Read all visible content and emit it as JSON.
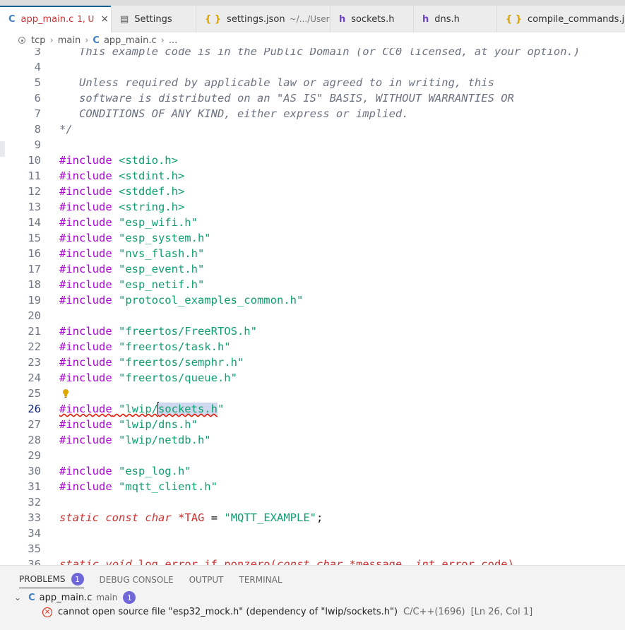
{
  "tabs": [
    {
      "icon": "c",
      "icon_char": "C",
      "label": "app_main.c",
      "detail": "1, U",
      "active": true,
      "error": true,
      "close": "×"
    },
    {
      "icon": "settings",
      "icon_char": "▤",
      "label": "Settings"
    },
    {
      "icon": "json",
      "icon_char": "{ }",
      "label": "settings.json",
      "desc": "~/.../User"
    },
    {
      "icon": "h",
      "icon_char": "h",
      "label": "sockets.h"
    },
    {
      "icon": "h",
      "icon_char": "h",
      "label": "dns.h"
    },
    {
      "icon": "json",
      "icon_char": "{ }",
      "label": "compile_commands.json"
    }
  ],
  "breadcrumbs": {
    "folder1": "tcp",
    "folder2": "main",
    "file_icon": "C",
    "file": "app_main.c",
    "more": "...",
    "sep": "›"
  },
  "lines": [
    {
      "n": "3",
      "segs": [
        {
          "t": "   This example code is in the Public Domain (or CC0 licensed, at your option.)",
          "c": "com"
        }
      ]
    },
    {
      "n": "4",
      "segs": []
    },
    {
      "n": "5",
      "segs": [
        {
          "t": "   Unless required by applicable law or agreed to in writing, this",
          "c": "com"
        }
      ]
    },
    {
      "n": "6",
      "segs": [
        {
          "t": "   software is distributed on an \"AS IS\" BASIS, WITHOUT WARRANTIES OR",
          "c": "com"
        }
      ]
    },
    {
      "n": "7",
      "segs": [
        {
          "t": "   CONDITIONS OF ANY KIND, either express or implied.",
          "c": "com"
        }
      ]
    },
    {
      "n": "8",
      "segs": [
        {
          "t": "*/",
          "c": "com"
        }
      ]
    },
    {
      "n": "9",
      "segs": []
    },
    {
      "n": "10",
      "segs": [
        {
          "t": "#include",
          "c": "inc"
        },
        {
          "t": " <stdio.h>",
          "c": "str"
        }
      ]
    },
    {
      "n": "11",
      "segs": [
        {
          "t": "#include",
          "c": "inc"
        },
        {
          "t": " <stdint.h>",
          "c": "str"
        }
      ]
    },
    {
      "n": "12",
      "segs": [
        {
          "t": "#include",
          "c": "inc"
        },
        {
          "t": " <stddef.h>",
          "c": "str"
        }
      ]
    },
    {
      "n": "13",
      "segs": [
        {
          "t": "#include",
          "c": "inc"
        },
        {
          "t": " <string.h>",
          "c": "str"
        }
      ]
    },
    {
      "n": "14",
      "segs": [
        {
          "t": "#include",
          "c": "inc"
        },
        {
          "t": " \"esp_wifi.h\"",
          "c": "str"
        }
      ]
    },
    {
      "n": "15",
      "segs": [
        {
          "t": "#include",
          "c": "inc"
        },
        {
          "t": " \"esp_system.h\"",
          "c": "str"
        }
      ]
    },
    {
      "n": "16",
      "segs": [
        {
          "t": "#include",
          "c": "inc"
        },
        {
          "t": " \"nvs_flash.h\"",
          "c": "str"
        }
      ]
    },
    {
      "n": "17",
      "segs": [
        {
          "t": "#include",
          "c": "inc"
        },
        {
          "t": " \"esp_event.h\"",
          "c": "str"
        }
      ]
    },
    {
      "n": "18",
      "segs": [
        {
          "t": "#include",
          "c": "inc"
        },
        {
          "t": " \"esp_netif.h\"",
          "c": "str"
        }
      ]
    },
    {
      "n": "19",
      "segs": [
        {
          "t": "#include",
          "c": "inc"
        },
        {
          "t": " \"protocol_examples_common.h\"",
          "c": "str"
        }
      ]
    },
    {
      "n": "20",
      "segs": []
    },
    {
      "n": "21",
      "segs": [
        {
          "t": "#include",
          "c": "inc"
        },
        {
          "t": " \"freertos/FreeRTOS.h\"",
          "c": "str"
        }
      ]
    },
    {
      "n": "22",
      "segs": [
        {
          "t": "#include",
          "c": "inc"
        },
        {
          "t": " \"freertos/task.h\"",
          "c": "str"
        }
      ]
    },
    {
      "n": "23",
      "segs": [
        {
          "t": "#include",
          "c": "inc"
        },
        {
          "t": " \"freertos/semphr.h\"",
          "c": "str"
        }
      ]
    },
    {
      "n": "24",
      "segs": [
        {
          "t": "#include",
          "c": "inc"
        },
        {
          "t": " \"freertos/queue.h\"",
          "c": "str"
        }
      ]
    },
    {
      "n": "25",
      "segs": [],
      "bulb": true
    },
    {
      "n": "26",
      "current": true,
      "segs": [
        {
          "t": "#include",
          "c": "inc",
          "sq": true
        },
        {
          "t": " \"lwip/",
          "c": "str",
          "sq": true
        },
        {
          "cursor": true
        },
        {
          "t": "sockets.h",
          "c": "str",
          "sq": true,
          "hl": true
        },
        {
          "t": "\"",
          "c": "str"
        }
      ]
    },
    {
      "n": "27",
      "segs": [
        {
          "t": "#include",
          "c": "inc"
        },
        {
          "t": " \"lwip/dns.h\"",
          "c": "str"
        }
      ]
    },
    {
      "n": "28",
      "segs": [
        {
          "t": "#include",
          "c": "inc"
        },
        {
          "t": " \"lwip/netdb.h\"",
          "c": "str"
        }
      ]
    },
    {
      "n": "29",
      "segs": []
    },
    {
      "n": "30",
      "segs": [
        {
          "t": "#include",
          "c": "inc"
        },
        {
          "t": " \"esp_log.h\"",
          "c": "str"
        }
      ]
    },
    {
      "n": "31",
      "segs": [
        {
          "t": "#include",
          "c": "inc"
        },
        {
          "t": " \"mqtt_client.h\"",
          "c": "str"
        }
      ]
    },
    {
      "n": "32",
      "segs": []
    },
    {
      "n": "33",
      "segs": [
        {
          "t": "static",
          "c": "kw"
        },
        {
          "t": " ",
          "c": "plain"
        },
        {
          "t": "const",
          "c": "kw"
        },
        {
          "t": " ",
          "c": "plain"
        },
        {
          "t": "char",
          "c": "type"
        },
        {
          "t": " ",
          "c": "plain"
        },
        {
          "t": "*TAG",
          "c": "var"
        },
        {
          "t": " = ",
          "c": "plain"
        },
        {
          "t": "\"MQTT_EXAMPLE\"",
          "c": "str"
        },
        {
          "t": ";",
          "c": "plain"
        }
      ]
    },
    {
      "n": "34",
      "segs": []
    },
    {
      "n": "35",
      "segs": []
    },
    {
      "n": "36",
      "segs": [
        {
          "t": "static",
          "c": "kw"
        },
        {
          "t": " ",
          "c": "plain"
        },
        {
          "t": "void",
          "c": "type"
        },
        {
          "t": " log_error_if_nonzero(",
          "c": "var"
        },
        {
          "t": "const",
          "c": "kw"
        },
        {
          "t": " ",
          "c": "plain"
        },
        {
          "t": "char",
          "c": "type"
        },
        {
          "t": " *message, ",
          "c": "var"
        },
        {
          "t": "int",
          "c": "type"
        },
        {
          "t": " error_code)",
          "c": "var"
        }
      ]
    }
  ],
  "panel": {
    "tabs": [
      {
        "label": "PROBLEMS",
        "badge": "1",
        "active": true
      },
      {
        "label": "DEBUG CONSOLE"
      },
      {
        "label": "OUTPUT"
      },
      {
        "label": "TERMINAL"
      }
    ],
    "chevron": "⌄",
    "file_icon": "C",
    "file": "app_main.c",
    "folder": "main",
    "count": "1",
    "error_icon": "×",
    "message": "cannot open source file \"esp32_mock.h\" (dependency of \"lwip/sockets.h\")",
    "source": "C/C++(1696)",
    "location": "[Ln 26, Col 1]"
  }
}
